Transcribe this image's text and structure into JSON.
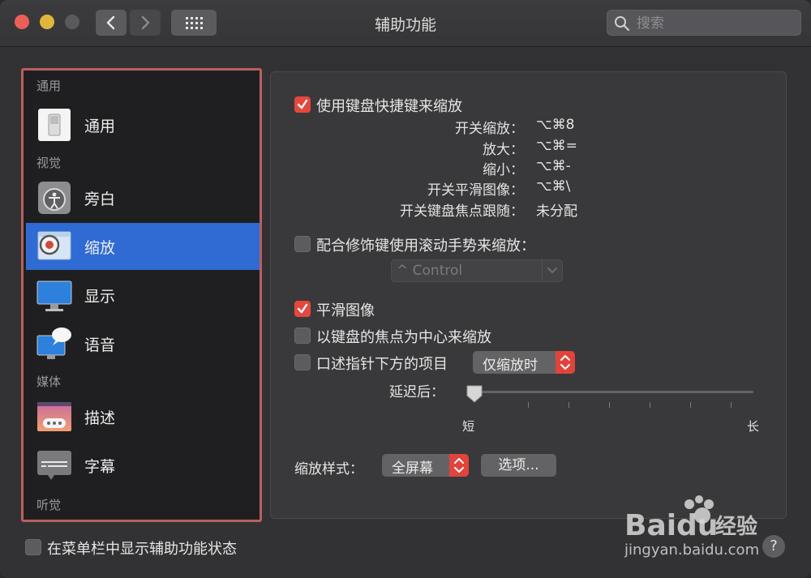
{
  "window": {
    "title": "辅助功能"
  },
  "search": {
    "placeholder": "搜索"
  },
  "sidebar": {
    "sections": [
      {
        "label": "通用"
      },
      {
        "label": "视觉"
      },
      {
        "label": "媒体"
      },
      {
        "label": "听觉"
      }
    ],
    "items": [
      {
        "label": "通用",
        "icon": "switch-icon"
      },
      {
        "label": "旁白",
        "icon": "voiceover-icon"
      },
      {
        "label": "缩放",
        "icon": "zoom-icon",
        "selected": true
      },
      {
        "label": "显示",
        "icon": "display-icon"
      },
      {
        "label": "语音",
        "icon": "speech-icon"
      },
      {
        "label": "描述",
        "icon": "descriptions-icon"
      },
      {
        "label": "字幕",
        "icon": "captions-icon"
      }
    ]
  },
  "zoom": {
    "keyboard_shortcuts": {
      "label": "使用键盘快捷键来缩放",
      "checked": true
    },
    "shortcuts": [
      {
        "label": "开关缩放：",
        "keys": "⌥⌘8"
      },
      {
        "label": "放大：",
        "keys": "⌥⌘="
      },
      {
        "label": "缩小：",
        "keys": "⌥⌘-"
      },
      {
        "label": "开关平滑图像：",
        "keys": "⌥⌘\\"
      },
      {
        "label": "开关键盘焦点跟随：",
        "keys": "未分配"
      }
    ],
    "scroll_gesture": {
      "label": "配合修饰键使用滚动手势来缩放：",
      "checked": false,
      "modifier": "^ Control"
    },
    "smooth_images": {
      "label": "平滑图像",
      "checked": true
    },
    "follow_focus": {
      "label": "以键盘的焦点为中心来缩放",
      "checked": false
    },
    "speak_items": {
      "label": "口述指针下方的项目",
      "checked": false,
      "mode": "仅缩放时"
    },
    "delay": {
      "label": "延迟后：",
      "min_label": "短",
      "max_label": "长",
      "value": 0
    },
    "style": {
      "label": "缩放样式：",
      "value": "全屏幕",
      "options_button": "选项..."
    }
  },
  "footer": {
    "menubar_status": {
      "label": "在菜单栏中显示辅助功能状态",
      "checked": false
    }
  },
  "watermark": {
    "brand": "Bai du 经验",
    "url": "jingyan.baidu.com"
  },
  "help": {
    "label": "?"
  },
  "colors": {
    "accent": "#e5473e",
    "selection": "#2f6bd3",
    "sidebar_border": "#b86060"
  }
}
